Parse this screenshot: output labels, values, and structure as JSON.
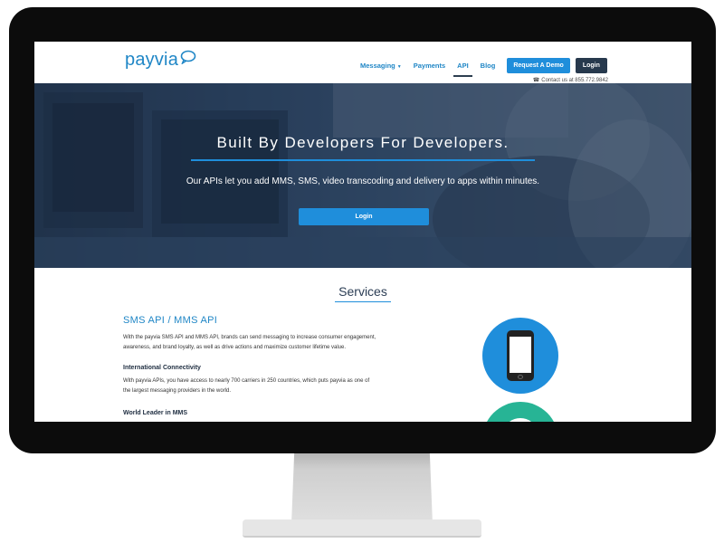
{
  "header": {
    "logo_text": "payvia",
    "nav": [
      {
        "label": "Messaging",
        "has_dropdown": true
      },
      {
        "label": "Payments"
      },
      {
        "label": "API",
        "active": true
      },
      {
        "label": "Blog"
      }
    ],
    "request_demo_label": "Request A Demo",
    "login_label": "Login",
    "contact_text": "Contact us at 855.772.9842"
  },
  "hero": {
    "title": "Built By Developers For Developers.",
    "subtitle": "Our APIs let you add MMS, SMS, video transcoding and delivery to apps within minutes.",
    "button_label": "Login"
  },
  "services": {
    "title": "Services",
    "sms_heading": "SMS API / MMS API",
    "sms_text_line1": "With the payvia SMS API and MMS API, brands can send messaging to increase consumer engagement,",
    "sms_text_line2": "awareness, and brand loyalty, as well as drive actions and maximize customer lifetime value.",
    "intl_heading": "International Connectivity",
    "intl_text_line1": "With payvia APIs, you have access to nearly 700 carriers in 250 countries, which puts payvia as one of",
    "intl_text_line2": "the largest messaging providers in the world.",
    "mms_heading": "World Leader in MMS"
  },
  "colors": {
    "brand_blue": "#1f86c6",
    "button_blue": "#1f8edb",
    "dark_navy": "#27394d",
    "teal": "#27b495"
  },
  "icons": [
    "chat-bubble-icon",
    "phone-icon",
    "smartphone-icon",
    "caret-down-icon"
  ]
}
